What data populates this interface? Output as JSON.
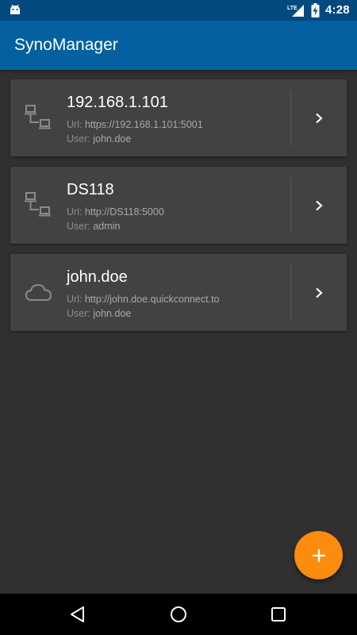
{
  "status_bar": {
    "network": "LTE",
    "time": "4:28",
    "icons": [
      "android-icon",
      "lte-signal-icon",
      "battery-charging-icon"
    ]
  },
  "app_bar": {
    "title": "SynoManager"
  },
  "servers": [
    {
      "name": "192.168.1.101",
      "url_label": "Url:",
      "url": "https://192.168.1.101:5001",
      "user_label": "User:",
      "user": "john.doe",
      "icon": "local-network-icon"
    },
    {
      "name": "DS118",
      "url_label": "Url:",
      "url": "http://DS118:5000",
      "user_label": "User:",
      "user": "admin",
      "icon": "local-network-icon"
    },
    {
      "name": "john.doe",
      "url_label": "Url:",
      "url": "http://john.doe.quickconnect.to",
      "user_label": "User:",
      "user": "john.doe",
      "icon": "cloud-icon"
    }
  ],
  "fab": {
    "icon": "plus-icon",
    "color": "#fb8c0e"
  },
  "nav_bar": {
    "icons": [
      "back-icon",
      "home-icon",
      "recents-icon"
    ]
  },
  "colors": {
    "status_bar": "#004a7f",
    "app_bar": "#0560a0",
    "background": "#303030",
    "card": "#424242"
  }
}
